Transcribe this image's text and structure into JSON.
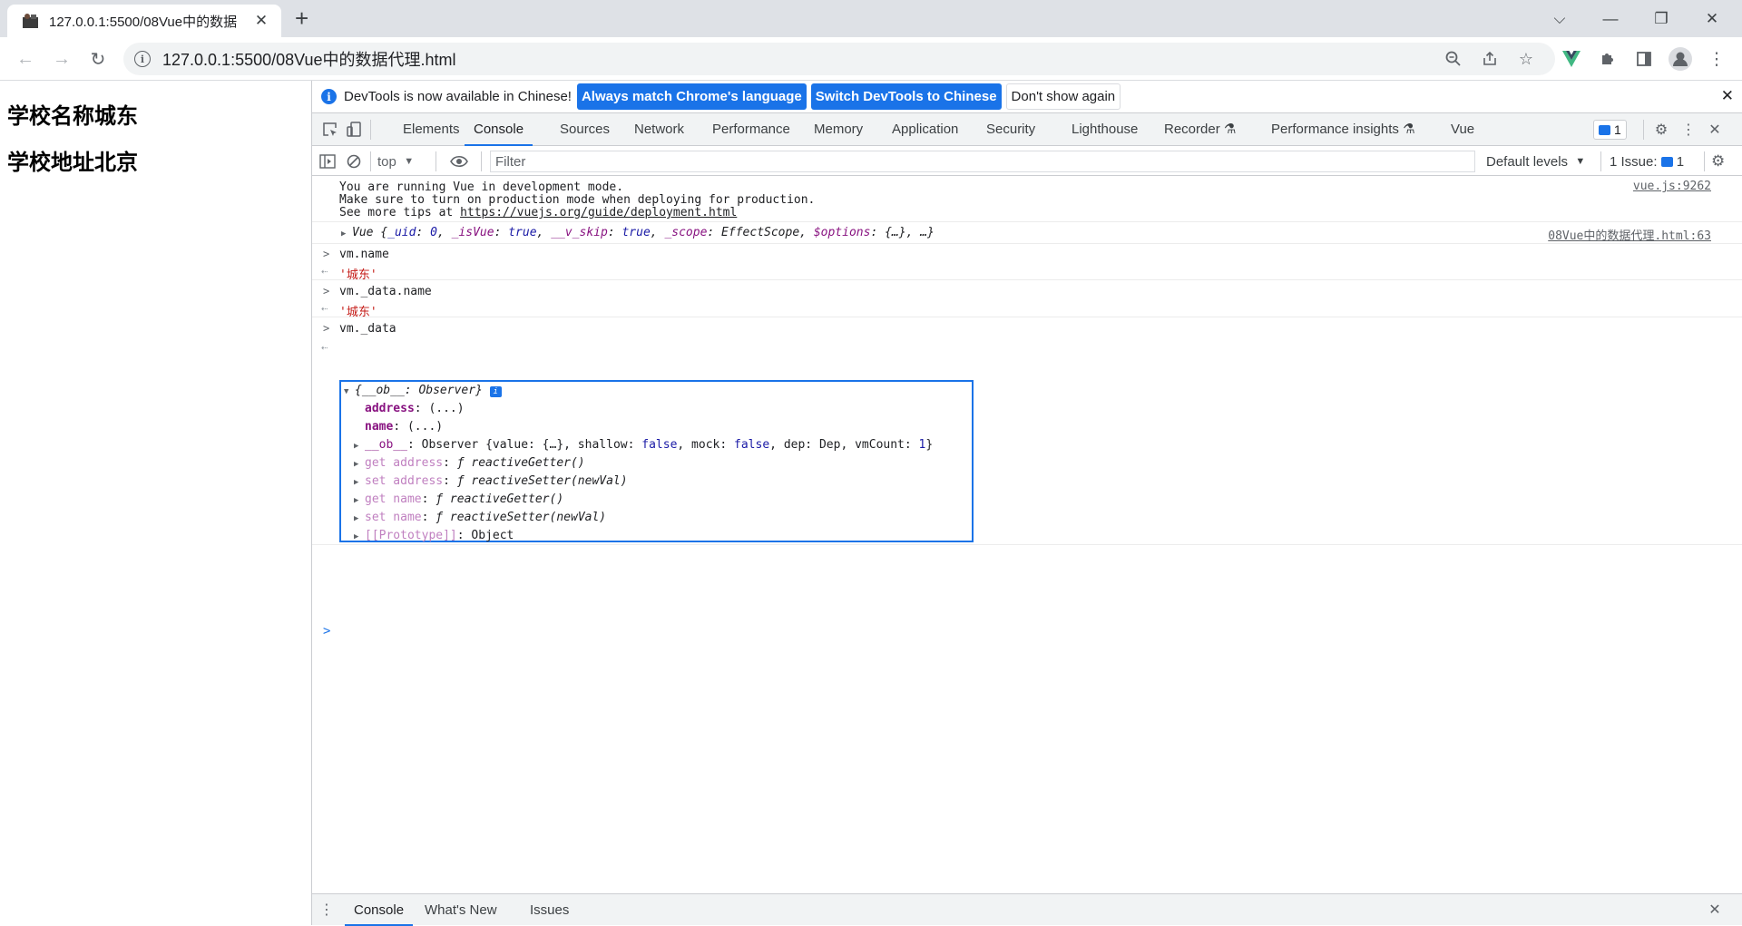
{
  "browser": {
    "tab_title": "127.0.0.1:5500/08Vue中的数据",
    "tab_close": "✕",
    "new_tab": "+",
    "url": "127.0.0.1:5500/08Vue中的数据代理.html",
    "window_controls": {
      "chevron": "⌵",
      "minimize": "—",
      "restore": "❐",
      "close": "✕"
    }
  },
  "page": {
    "heading1": "学校名称城东",
    "heading2": "学校地址北京"
  },
  "devtools": {
    "infobar": {
      "message": "DevTools is now available in Chinese!",
      "btn_match": "Always match Chrome's language",
      "btn_switch": "Switch DevTools to Chinese",
      "btn_dismiss": "Don't show again"
    },
    "tabs": [
      "Elements",
      "Console",
      "Sources",
      "Network",
      "Performance",
      "Memory",
      "Application",
      "Security",
      "Lighthouse",
      "Recorder",
      "Performance insights",
      "Vue"
    ],
    "active_tab": "Console",
    "messages_badge": "1",
    "filter": {
      "context": "top",
      "placeholder": "Filter",
      "levels": "Default levels",
      "issues_label": "1 Issue:",
      "issues_count": "1"
    },
    "console": {
      "vue_msg_line1": "You are running Vue in development mode.",
      "vue_msg_line2": "Make sure to turn on production mode when deploying for production.",
      "vue_msg_line3_prefix": "See more tips at ",
      "vue_msg_link": "https://vuejs.org/guide/deployment.html",
      "vue_msg_source": "vue.js:9262",
      "vue_obj_source": "08Vue中的数据代理.html:63",
      "cmd1": "vm.name",
      "res1": "'城东'",
      "cmd2": "vm._data.name",
      "res2": "'城东'",
      "cmd3": "vm._data",
      "obj_header": "{__ob__: Observer}",
      "prop_address": "address",
      "prop_name": "name",
      "lazy": "(...)",
      "ob_key": "__ob__",
      "ob_val_1": "Observer {value: {…}, shallow: ",
      "ob_false": "false",
      "ob_val_2": ", mock: ",
      "ob_val_3": ", dep: Dep, vmCount: ",
      "ob_vmcount": "1",
      "ob_val_4": "}",
      "get_address": "get address",
      "set_address": "set address",
      "get_name": "get name",
      "set_name": "set name",
      "getter_fn": "ƒ reactiveGetter()",
      "setter_fn": "ƒ reactiveSetter(newVal)",
      "proto_key": "[[Prototype]]",
      "proto_val": "Object"
    },
    "bottom_tabs": [
      "Console",
      "What's New",
      "Issues"
    ]
  }
}
